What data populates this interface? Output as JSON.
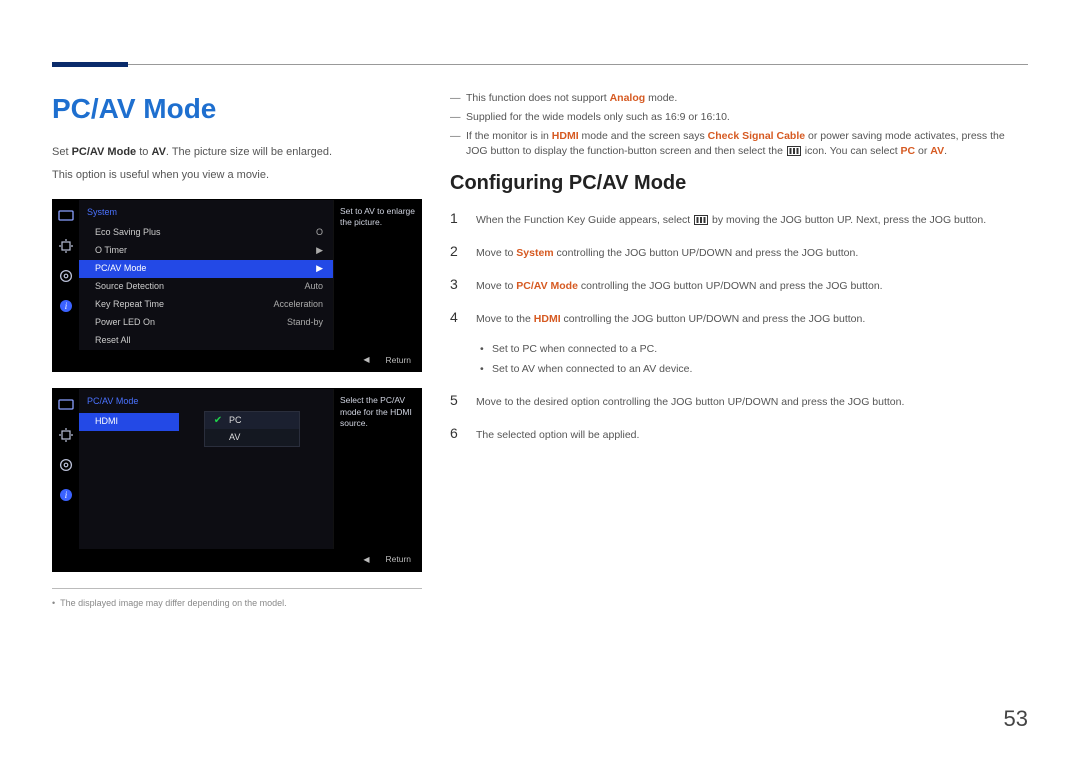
{
  "page_number": "53",
  "title": "PC/AV Mode",
  "intro": {
    "line1_pre": "Set ",
    "line1_bold1": "PC/AV Mode",
    "line1_mid": " to ",
    "line1_bold2": "AV",
    "line1_post": ". The picture size will be enlarged.",
    "line2": "This option is useful when you view a movie."
  },
  "osd1": {
    "header": "System",
    "hint": "Set to AV to enlarge the picture.",
    "items": [
      {
        "label": "Eco Saving Plus",
        "value": "O"
      },
      {
        "label": "O   Timer",
        "value": "▶"
      },
      {
        "label": "PC/AV Mode",
        "value": "▶",
        "selected": true
      },
      {
        "label": "Source Detection",
        "value": "Auto"
      },
      {
        "label": "Key Repeat Time",
        "value": "Acceleration"
      },
      {
        "label": "Power LED On",
        "value": "Stand-by"
      },
      {
        "label": "Reset All",
        "value": ""
      }
    ],
    "footer_return": "Return"
  },
  "osd2": {
    "header": "PC/AV Mode",
    "hint": "Select the PC/AV mode for the HDMI source.",
    "row_label": "HDMI",
    "popup": [
      {
        "label": "PC",
        "selected": true
      },
      {
        "label": "AV",
        "selected": false
      }
    ],
    "footer_return": "Return"
  },
  "left_footnote": "The displayed image may differ depending on the model.",
  "notes": {
    "n1_pre": "This function does not support ",
    "n1_bold": "Analog",
    "n1_post": " mode.",
    "n2": "Supplied for the wide models only such as 16:9 or 16:10.",
    "n3_pre": "If the monitor is in ",
    "n3_b1": "HDMI",
    "n3_mid1": " mode and the screen says ",
    "n3_b2": "Check Signal Cable",
    "n3_mid2": " or power saving mode activates, press the JOG button to display the function-button screen and then select the ",
    "n3_mid3": " icon. You can select ",
    "n3_b3": "PC",
    "n3_mid4": " or ",
    "n3_b4": "AV",
    "n3_post": "."
  },
  "section_title": "Configuring PC/AV Mode",
  "steps": {
    "s1_pre": "When the Function Key Guide appears, select ",
    "s1_post": " by moving the JOG button UP. Next, press the JOG button.",
    "s2_pre": "Move to ",
    "s2_b": "System",
    "s2_post": " controlling the JOG button UP/DOWN and press the JOG button.",
    "s3_pre": "Move to ",
    "s3_b": "PC/AV Mode",
    "s3_post": " controlling the JOG button UP/DOWN and press the JOG button.",
    "s4_pre": "Move to the ",
    "s4_b": "HDMI",
    "s4_post": " controlling the JOG button UP/DOWN and press the JOG button.",
    "sub1": "Set to PC when connected to a PC.",
    "sub2": "Set to AV when connected to an AV device.",
    "s5": "Move to the desired option controlling the JOG button UP/DOWN and press the JOG button.",
    "s6": "The selected option will be applied."
  }
}
